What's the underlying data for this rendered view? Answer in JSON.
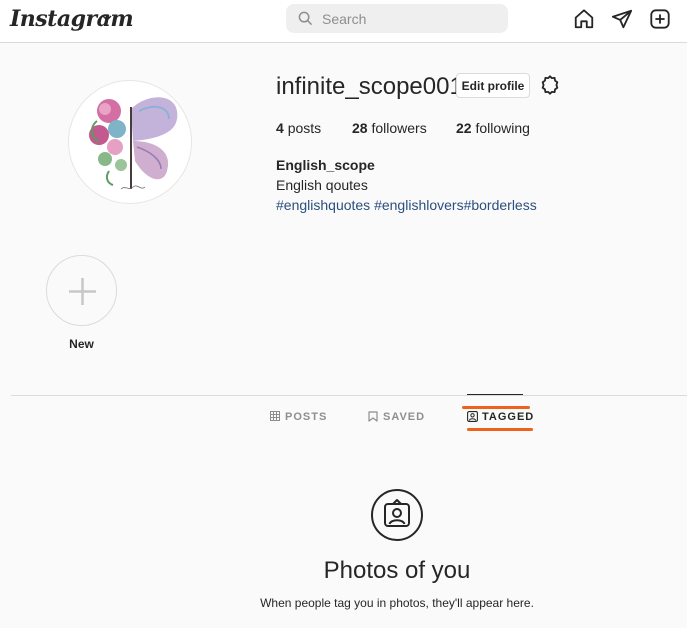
{
  "topbar": {
    "logo": "Instagram",
    "search_placeholder": "Search",
    "icons": [
      "home-icon",
      "direct-icon",
      "new-post-icon"
    ]
  },
  "profile": {
    "username": "infinite_scope001",
    "edit_profile_label": "Edit profile",
    "stats": {
      "posts_count": "4",
      "posts_label": "posts",
      "followers_count": "28",
      "followers_label": "followers",
      "following_count": "22",
      "following_label": "following"
    },
    "full_name": "English_scope",
    "bio": "English qoutes",
    "hashtags": "#englishquotes #englishlovers#borderless"
  },
  "highlights": {
    "new_label": "New"
  },
  "tabs": [
    {
      "label": "POSTS",
      "icon": "grid-icon",
      "active": false
    },
    {
      "label": "SAVED",
      "icon": "bookmark-icon",
      "active": false
    },
    {
      "label": "TAGGED",
      "icon": "tagged-icon",
      "active": true
    }
  ],
  "empty_state": {
    "title": "Photos of you",
    "subtitle": "When people tag you in photos, they'll appear here."
  },
  "colors": {
    "annotation": "#f0621b",
    "hashtag": "#2b4f7e",
    "border": "#dbdbdb"
  }
}
